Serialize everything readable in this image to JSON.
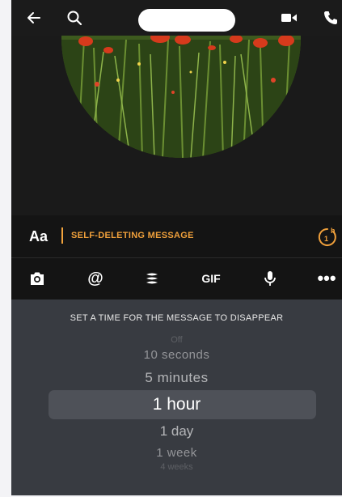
{
  "composer": {
    "aa_label": "Aa",
    "placeholder": "SELF-DELETING MESSAGE",
    "timer_badge": "h",
    "timer_number": "1"
  },
  "toolbar": {
    "gif_label": "GIF",
    "mention_label": "@",
    "more_label": "•••"
  },
  "picker": {
    "title": "SET A TIME FOR THE MESSAGE TO DISAPPEAR",
    "options": [
      "Off",
      "10 seconds",
      "5 minutes",
      "1 hour",
      "1 day",
      "1 week",
      "4 weeks"
    ],
    "selected": "1 hour"
  },
  "icons": {
    "back": "back-arrow-icon",
    "search": "search-icon",
    "video": "video-call-icon",
    "call": "phone-call-icon",
    "camera": "camera-icon",
    "stack": "stack-icon",
    "mic": "microphone-icon",
    "timer": "timer-icon"
  },
  "colors": {
    "accent": "#f0a03b",
    "background": "#141414",
    "picker_bg": "#383b41",
    "selection_band": "#4e5158"
  }
}
